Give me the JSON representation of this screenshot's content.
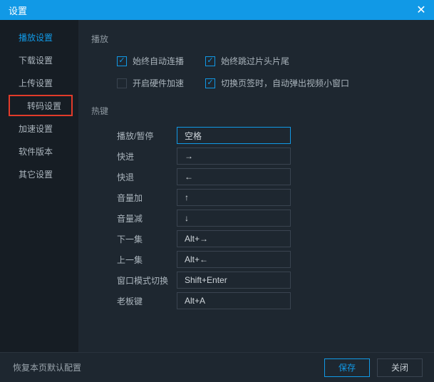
{
  "title": "设置",
  "sidebar": {
    "items": [
      {
        "label": "播放设置"
      },
      {
        "label": "下载设置"
      },
      {
        "label": "上传设置"
      },
      {
        "label": "转码设置"
      },
      {
        "label": "加速设置"
      },
      {
        "label": "软件版本"
      },
      {
        "label": "其它设置"
      }
    ]
  },
  "content": {
    "playback_title": "播放",
    "cb_autoplay": "始终自动连播",
    "cb_skip": "始终跳过片头片尾",
    "cb_hwacc": "开启硬件加速",
    "cb_popup": "切换页签时，自动弹出视频小窗口",
    "hotkeys_title": "热键",
    "hk": [
      {
        "label": "播放/暂停",
        "value": "空格"
      },
      {
        "label": "快进",
        "value": "→"
      },
      {
        "label": "快退",
        "value": "←"
      },
      {
        "label": "音量加",
        "value": "↑"
      },
      {
        "label": "音量减",
        "value": "↓"
      },
      {
        "label": "下一集",
        "value": "Alt+→"
      },
      {
        "label": "上一集",
        "value": "Alt+←"
      },
      {
        "label": "窗口模式切换",
        "value": "Shift+Enter"
      },
      {
        "label": "老板键",
        "value": "Alt+A"
      }
    ]
  },
  "footer": {
    "reset": "恢复本页默认配置",
    "save": "保存",
    "close": "关闭"
  }
}
